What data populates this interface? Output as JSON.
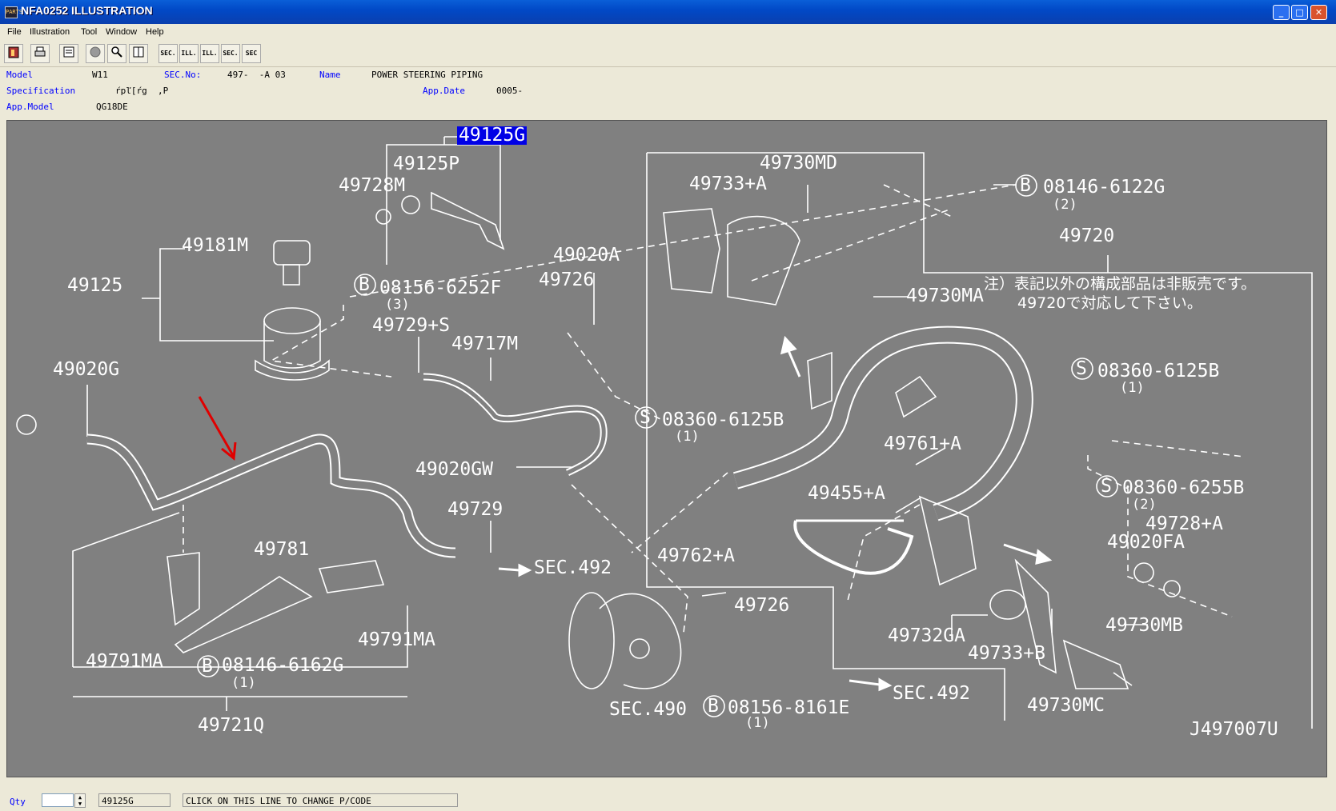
{
  "window": {
    "icon_text": "PARTS",
    "title": "NFA0252  ILLUSTRATION",
    "min": "_",
    "max": "□",
    "close": "✕"
  },
  "menu": [
    "File",
    "Illustration",
    "Tool",
    "Window",
    "Help"
  ],
  "toolbar": [
    "",
    "",
    "",
    "",
    "",
    "",
    "SEC.",
    "ILL.",
    "ILL.",
    "SEC.",
    "SEC"
  ],
  "info": {
    "model_label": "Model",
    "model": "W11",
    "secno_label": "SEC.No:",
    "secno": "497-  -A 03",
    "name_label": "Name",
    "name": "POWER STEERING PIPING",
    "spec_label": "Specification",
    "spec": "ŕpľ[ŕg  ,P",
    "appdate_label": "App.Date",
    "appdate": "0005-",
    "appmodel_label": "App.Model",
    "appmodel": "QG18DE"
  },
  "parts": {
    "p49125G": "49125G",
    "p49125P": "49125P",
    "p49728M": "49728M",
    "p49181M": "49181M",
    "p49125": "49125",
    "p08156_6252F": "08156-6252F",
    "q3a": "(3)",
    "p49729S": "49729+S",
    "p49717M": "49717M",
    "p49020A": "49020A",
    "p49726a": "49726",
    "p49020G": "49020G",
    "p49020GW": "49020GW",
    "p49729": "49729",
    "sec492a": "SEC.492",
    "p49781": "49781",
    "p49791MAa": "49791MA",
    "p49791MAb": "49791MA",
    "p08146_6162G": "08146-6162G",
    "q1a": "(1)",
    "p49721Q": "49721Q",
    "p49730MD": "49730MD",
    "p49733A": "49733+A",
    "p08146_6122G": "08146-6122G",
    "q2a": "(2)",
    "p49720": "49720",
    "p49730MA": "49730MA",
    "p08360_6125Ba": "08360-6125B",
    "q1b": "(1)",
    "p08360_6125Bb": "08360-6125B",
    "q1c": "(1)",
    "p49761A": "49761+A",
    "p49455A": "49455+A",
    "p49762A": "49762+A",
    "p49726b": "49726",
    "p08360_6255B": "08360-6255B",
    "q2b": "(2)",
    "p49728A": "49728+A",
    "p49020FA": "49020FA",
    "p49732GA": "49732GA",
    "p49733B": "49733+B",
    "p49730MB": "49730MB",
    "p49730MC": "49730MC",
    "sec492b": "SEC.492",
    "sec490": "SEC.490",
    "p08156_8161E": "08156-8161E",
    "q1d": "(1)",
    "drawing_no": "J497007U"
  },
  "bubbles": {
    "b": "B",
    "s": "S"
  },
  "note": {
    "line1": "注）表記以外の構成部品は非販売です。",
    "line2": "49720で対応して下さい。"
  },
  "status": {
    "qty_label": "Qty",
    "qty_value": "",
    "pcode": "49125G",
    "message": "CLICK ON THIS LINE TO CHANGE P/CODE"
  }
}
